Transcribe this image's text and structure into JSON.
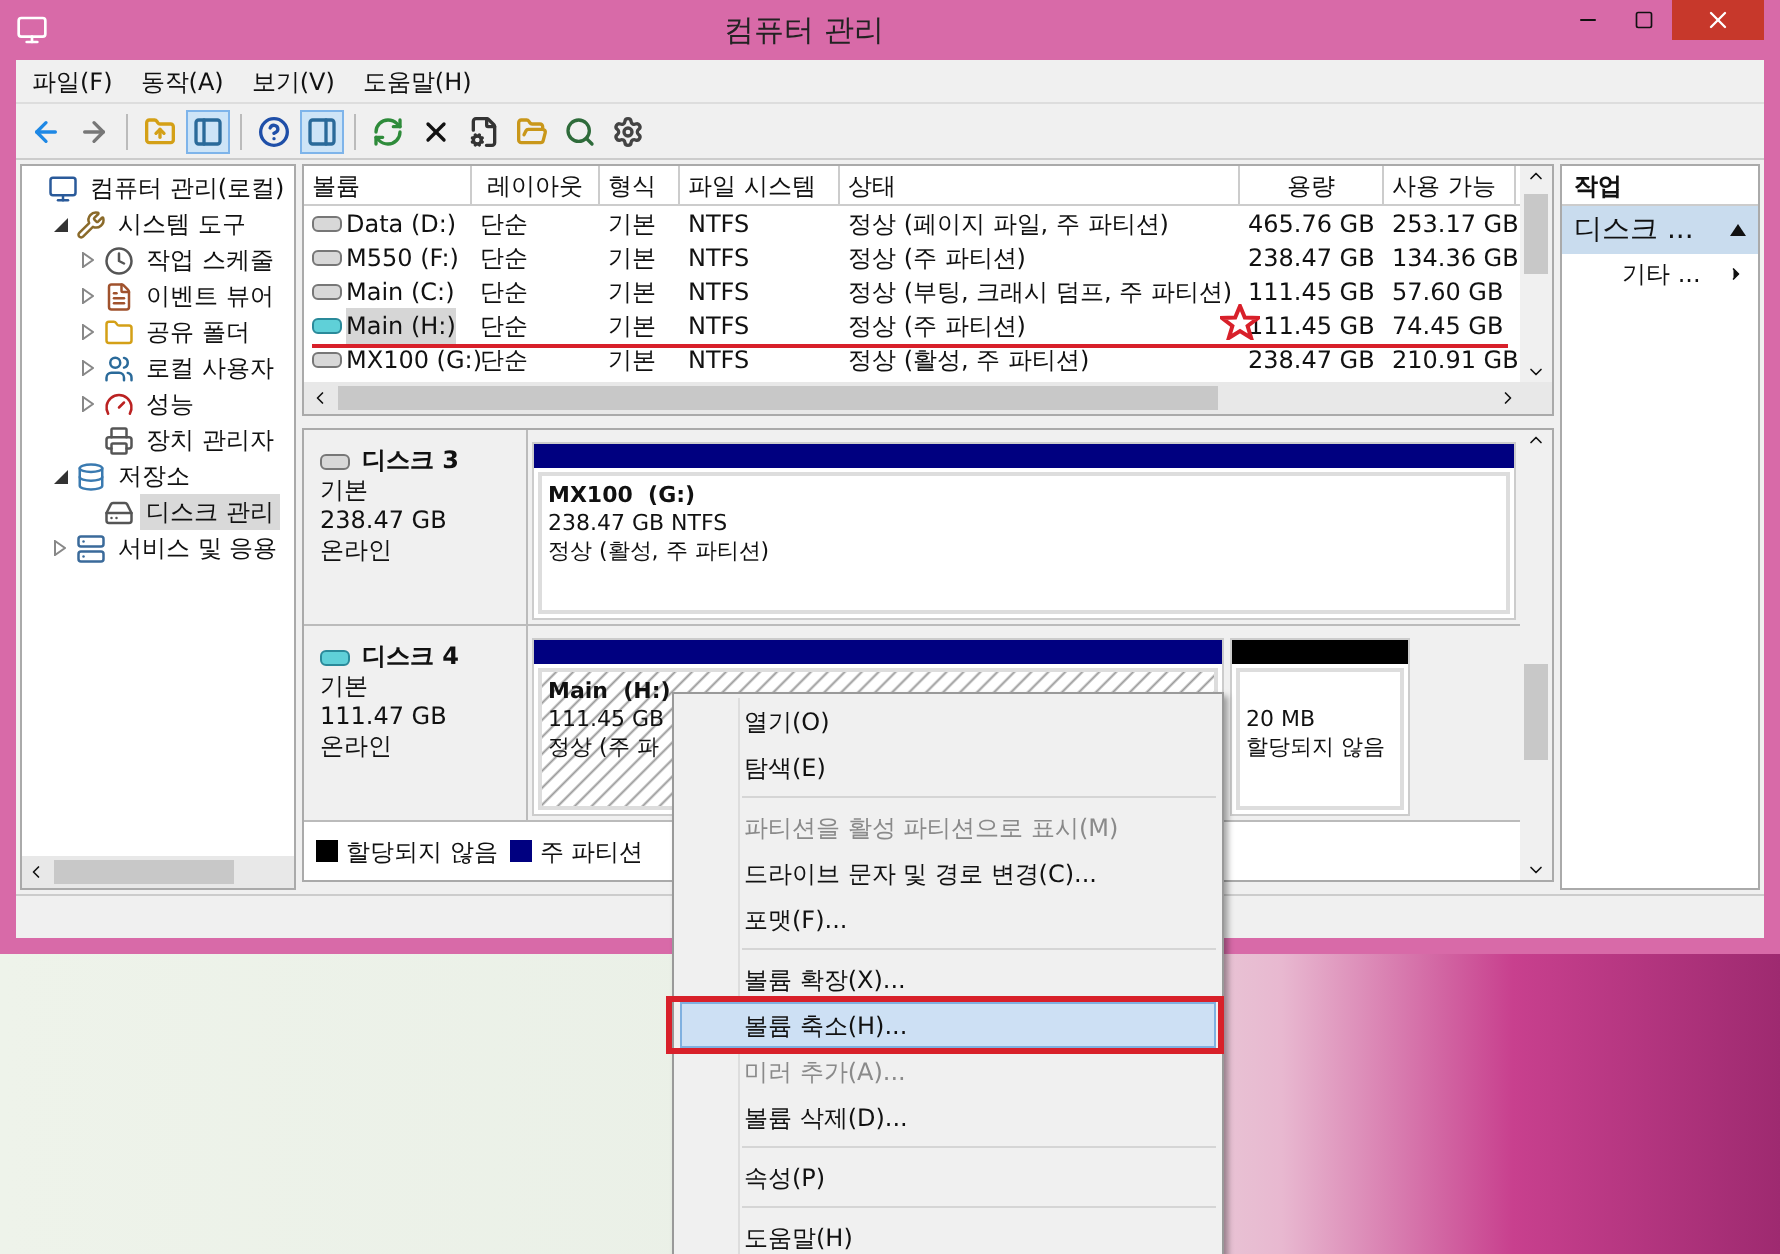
{
  "window": {
    "title": "컴퓨터 관리"
  },
  "menu_bar": [
    "파일(F)",
    "동작(A)",
    "보기(V)",
    "도움말(H)"
  ],
  "toolbar": [
    {
      "kind": "back",
      "pressed": false
    },
    {
      "kind": "forward",
      "pressed": false
    },
    {
      "kind": "sep"
    },
    {
      "kind": "up",
      "pressed": false
    },
    {
      "kind": "tree",
      "pressed": true
    },
    {
      "kind": "sep"
    },
    {
      "kind": "help",
      "pressed": false
    },
    {
      "kind": "actionpane",
      "pressed": true
    },
    {
      "kind": "sep"
    },
    {
      "kind": "refresh",
      "pressed": false
    },
    {
      "kind": "delete",
      "pressed": false
    },
    {
      "kind": "properties",
      "pressed": false
    },
    {
      "kind": "open",
      "pressed": false
    },
    {
      "kind": "find",
      "pressed": false
    },
    {
      "kind": "settings",
      "pressed": false
    }
  ],
  "tree": [
    {
      "label": "컴퓨터 관리(로컬)",
      "kind": "computer",
      "selected": false,
      "children": [
        {
          "label": "시스템 도구",
          "kind": "tools",
          "expanded": true,
          "selected": false,
          "children": [
            {
              "label": "작업 스케줄",
              "kind": "clock",
              "expanded": false,
              "selected": false
            },
            {
              "label": "이벤트 뷰어",
              "kind": "log",
              "expanded": false,
              "selected": false
            },
            {
              "label": "공유 폴더",
              "kind": "folder",
              "expanded": false,
              "selected": false
            },
            {
              "label": "로컬 사용자",
              "kind": "users",
              "expanded": false,
              "selected": false
            },
            {
              "label": "성능",
              "kind": "gauge",
              "expanded": false,
              "selected": false
            },
            {
              "label": "장치 관리자",
              "kind": "device",
              "selected": false
            }
          ]
        },
        {
          "label": "저장소",
          "kind": "storage",
          "expanded": true,
          "selected": false,
          "children": [
            {
              "label": "디스크 관리",
              "kind": "disk",
              "selected": true
            }
          ]
        },
        {
          "label": "서비스 및 응용",
          "kind": "services",
          "expanded": false,
          "selected": false
        }
      ]
    }
  ],
  "volumes": {
    "columns": [
      "볼륨",
      "레이아웃",
      "형식",
      "파일 시스템",
      "상태",
      "용량",
      "사용 가능"
    ],
    "rows": [
      {
        "kind": "internal",
        "selected": false,
        "cells": [
          "Data (D:)",
          "단순",
          "기본",
          "NTFS",
          "정상 (페이지 파일, 주 파티션)",
          "465.76 GB",
          "253.17 GB"
        ]
      },
      {
        "kind": "internal",
        "selected": false,
        "cells": [
          "M550 (F:)",
          "단순",
          "기본",
          "NTFS",
          "정상 (주 파티션)",
          "238.47 GB",
          "134.36 GB"
        ]
      },
      {
        "kind": "internal",
        "selected": false,
        "cells": [
          "Main (C:)",
          "단순",
          "기본",
          "NTFS",
          "정상 (부팅, 크래시 덤프, 주 파티션)",
          "111.45 GB",
          "57.60 GB"
        ]
      },
      {
        "kind": "external",
        "selected": true,
        "cells": [
          "Main (H:)",
          "단순",
          "기본",
          "NTFS",
          "정상 (주 파티션)",
          "111.45 GB",
          "74.45 GB"
        ]
      },
      {
        "kind": "internal",
        "selected": false,
        "cells": [
          "MX100 (G:)",
          "단순",
          "기본",
          "NTFS",
          "정상 (활성, 주 파티션)",
          "238.47 GB",
          "210.91 GB"
        ]
      }
    ]
  },
  "disks": [
    {
      "name": "디스크 3",
      "kind": "internal",
      "type": "기본",
      "size": "238.47 GB",
      "status": "온라인",
      "partitions": [
        {
          "kind": "primary",
          "selected": false,
          "name": "MX100  (G:)",
          "size": "238.47 GB NTFS",
          "status": "정상 (활성, 주 파티션)"
        }
      ]
    },
    {
      "name": "디스크 4",
      "kind": "external",
      "type": "기본",
      "size": "111.47 GB",
      "status": "온라인",
      "partitions": [
        {
          "kind": "primary",
          "selected": true,
          "name": "Main  (H:)",
          "size": "111.45 GB",
          "status": "정상 (주 파"
        },
        {
          "kind": "unallocated",
          "selected": false,
          "size": "20 MB",
          "status": "할당되지 않음"
        }
      ]
    }
  ],
  "legend": [
    {
      "label": "할당되지 않음",
      "color": "#000000"
    },
    {
      "label": "주 파티션",
      "color": "#000080"
    }
  ],
  "actions": {
    "title": "작업",
    "sections": [
      {
        "label": "디스크 ...",
        "expanded": true,
        "items": [
          "기타 ..."
        ]
      }
    ]
  },
  "context_menu": {
    "items": [
      {
        "kind": "item",
        "label": "열기(O)",
        "disabled": false,
        "selected": false
      },
      {
        "kind": "item",
        "label": "탐색(E)",
        "disabled": false,
        "selected": false
      },
      {
        "kind": "separator"
      },
      {
        "kind": "item",
        "label": "파티션을 활성 파티션으로 표시(M)",
        "disabled": true,
        "selected": false
      },
      {
        "kind": "item",
        "label": "드라이브 문자 및 경로 변경(C)...",
        "disabled": false,
        "selected": false
      },
      {
        "kind": "item",
        "label": "포맷(F)...",
        "disabled": false,
        "selected": false
      },
      {
        "kind": "separator"
      },
      {
        "kind": "item",
        "label": "볼륨 확장(X)...",
        "disabled": false,
        "selected": false
      },
      {
        "kind": "item",
        "label": "볼륨 축소(H)...",
        "disabled": false,
        "selected": true
      },
      {
        "kind": "item",
        "label": "미러 추가(A)...",
        "disabled": true,
        "selected": false
      },
      {
        "kind": "item",
        "label": "볼륨 삭제(D)...",
        "disabled": false,
        "selected": false
      },
      {
        "kind": "separator"
      },
      {
        "kind": "item",
        "label": "속성(P)",
        "disabled": false,
        "selected": false
      },
      {
        "kind": "separator"
      },
      {
        "kind": "item",
        "label": "도움말(H)",
        "disabled": false,
        "selected": false
      }
    ]
  }
}
